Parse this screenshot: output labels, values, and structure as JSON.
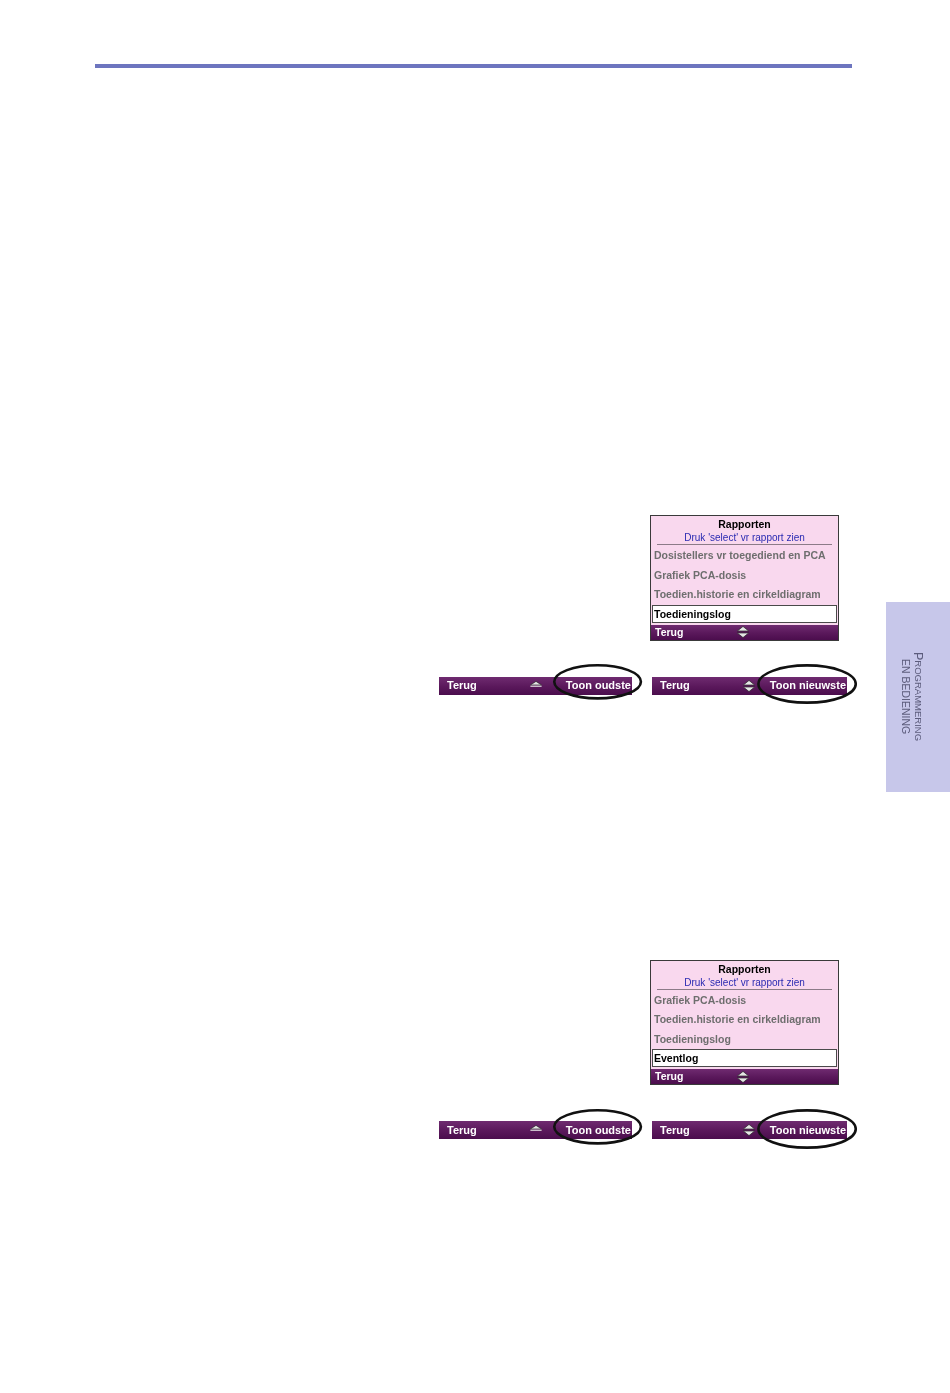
{
  "side_tab": {
    "lines": [
      "PROGRAMMERING",
      "EN BEDIENING"
    ]
  },
  "sections": [
    {
      "screen": {
        "title": "Rapporten",
        "hint": "Druk 'select' vr rapport zien",
        "items": [
          {
            "label": "Dosistellers vr toegediend en PCA",
            "selected": false
          },
          {
            "label": "Grafiek PCA-dosis",
            "selected": false
          },
          {
            "label": "Toedien.historie en cirkeldiagram",
            "selected": false
          },
          {
            "label": "Toedieningslog",
            "selected": true
          }
        ],
        "softkey": "Terug",
        "scroll_up": true,
        "scroll_down": true
      },
      "softkey_bars": [
        {
          "left": "Terug",
          "scroll_up": true,
          "scroll_down": false,
          "right": "Toon oudste",
          "circled": true
        },
        {
          "left": "Terug",
          "scroll_up": true,
          "scroll_down": true,
          "right": "Toon nieuwste",
          "circled": true
        }
      ]
    },
    {
      "screen": {
        "title": "Rapporten",
        "hint": "Druk 'select' vr rapport zien",
        "items": [
          {
            "label": "Grafiek PCA-dosis",
            "selected": false
          },
          {
            "label": "Toedien.historie en cirkeldiagram",
            "selected": false
          },
          {
            "label": "Toedieningslog",
            "selected": false
          },
          {
            "label": "Eventlog",
            "selected": true
          }
        ],
        "softkey": "Terug",
        "scroll_up": true,
        "scroll_down": true
      },
      "softkey_bars": [
        {
          "left": "Terug",
          "scroll_up": true,
          "scroll_down": false,
          "right": "Toon oudste",
          "circled": true
        },
        {
          "left": "Terug",
          "scroll_up": true,
          "scroll_down": true,
          "right": "Toon nieuwste",
          "circled": true
        }
      ]
    }
  ]
}
